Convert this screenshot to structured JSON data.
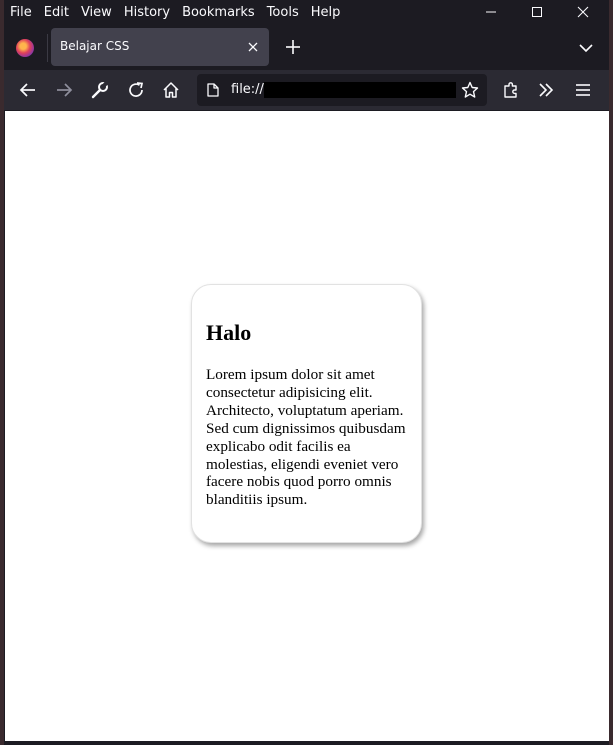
{
  "menubar": {
    "items": [
      "File",
      "Edit",
      "View",
      "History",
      "Bookmarks",
      "Tools",
      "Help"
    ]
  },
  "tab": {
    "title": "Belajar CSS"
  },
  "urlbar": {
    "text": "file:///"
  },
  "card": {
    "heading": "Halo",
    "body": "Lorem ipsum dolor sit amet consectetur adipisicing elit. Architecto, voluptatum aperiam. Sed cum dignissimos quibusdam explicabo odit facilis ea molestias, eligendi eveniet vero facere nobis quod porro omnis blanditiis ipsum."
  },
  "icons": {
    "browser": "firefox-logo",
    "back": "back-arrow-icon",
    "forward": "forward-arrow-icon",
    "tools": "wrench-icon",
    "reload": "reload-icon",
    "home": "home-icon",
    "page": "page-icon",
    "bookmark": "star-icon",
    "extensions": "puzzle-icon",
    "overflow": "double-chevron-icon",
    "menu": "hamburger-icon"
  },
  "colors": {
    "titlebar": "#1c1b22",
    "tab_active": "#42414d",
    "toolbar": "#2b2a33",
    "page_background": "#ffffff"
  }
}
